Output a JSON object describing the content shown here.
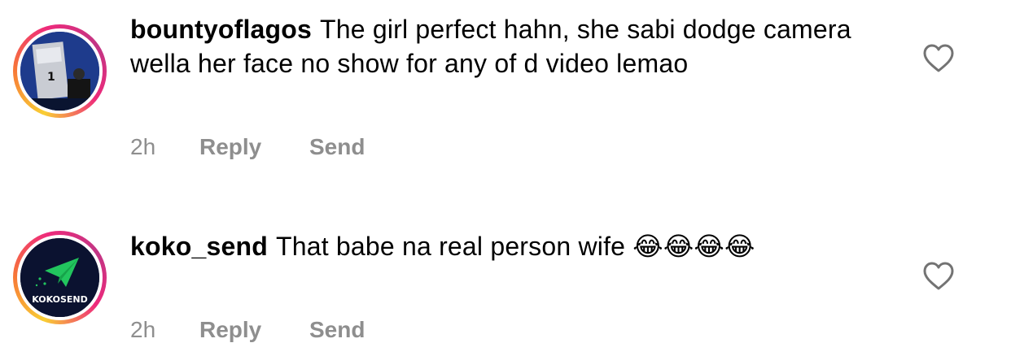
{
  "comments": [
    {
      "username": "bountyoflagos",
      "text": "The girl perfect hahn, she sabi dodge camera wella her face no show for any of d video lemao",
      "time": "2h",
      "reply_label": "Reply",
      "send_label": "Send",
      "avatar_icon": "photo-avatar"
    },
    {
      "username": "koko_send",
      "text": "That babe na real person wife 😂😂😂😂",
      "time": "2h",
      "reply_label": "Reply",
      "send_label": "Send",
      "avatar_logo_text": "KOKOSEND",
      "avatar_icon": "paper-plane-logo"
    }
  ],
  "like_icon": "heart-outline-icon",
  "colors": {
    "meta_text": "#8e8e8e",
    "ring_start": "#f9ce34",
    "ring_mid": "#ee2a7b",
    "ring_end": "#c13584",
    "logo_green": "#22c55e"
  }
}
